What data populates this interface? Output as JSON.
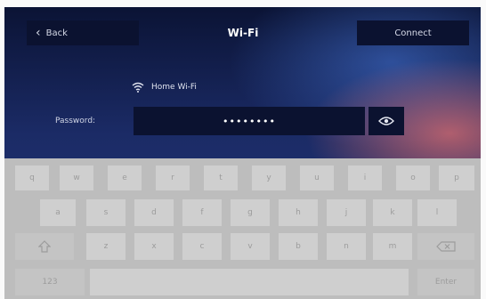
{
  "header": {
    "back_label": "Back",
    "title": "Wi-Fi",
    "connect_label": "Connect"
  },
  "network": {
    "name": "Home Wi-Fi",
    "icon": "wifi-icon"
  },
  "password": {
    "label": "Password:",
    "masked_value": "••••••••",
    "toggle_icon": "eye-icon"
  },
  "keyboard": {
    "row1": [
      "q",
      "w",
      "e",
      "r",
      "t",
      "y",
      "u",
      "i",
      "o",
      "p"
    ],
    "row2": [
      "a",
      "s",
      "d",
      "f",
      "g",
      "h",
      "j",
      "k",
      "l"
    ],
    "row3": [
      "z",
      "x",
      "c",
      "v",
      "b",
      "n",
      "m"
    ],
    "shift_icon": "shift-icon",
    "backspace_icon": "backspace-icon",
    "mode_label": "123",
    "enter_label": "Enter"
  },
  "colors": {
    "header_button_bg": "#0b1230",
    "keyboard_bg": "#bdbdbd",
    "key_bg": "#cfcfcf"
  }
}
